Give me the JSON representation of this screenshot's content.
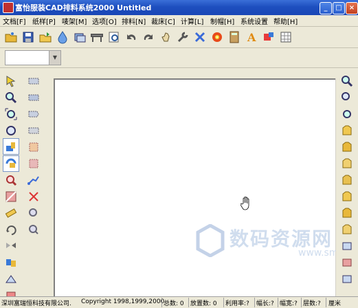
{
  "window": {
    "title": "富怡服装CAD排料系统2000 Untitled"
  },
  "menu": [
    "文档[F]",
    "纸样[P]",
    "唛架[M]",
    "选项[O]",
    "排料[N]",
    "裁床[C]",
    "计算[L]",
    "制帽[H]",
    "系统设置",
    "帮助[H]"
  ],
  "toolbar_icons": [
    "open-folder-icon",
    "save-icon",
    "open-icon",
    "drop-icon",
    "layer-icon",
    "table-icon",
    "preview-icon",
    "undo-icon",
    "redo-icon",
    "hand-icon",
    "wrench-icon",
    "tools-icon",
    "disc-icon",
    "calculator-icon",
    "text-icon",
    "color-icon",
    "grid-icon"
  ],
  "status": {
    "company": "深圳富瑞恒科技有限公司.",
    "copyright": "Copyright 1998,1999,2000",
    "total": "总数: 0",
    "placed": "放置数: 0",
    "usage": "利用率:?",
    "width_len": "幅长:?",
    "width": "幅宽:?",
    "layers": "层数:?",
    "unit": "厘米"
  },
  "watermark": {
    "text": "数码资源网",
    "url": "www.smzy.com"
  },
  "colors": {
    "title_bar": "#1e4fbf",
    "canvas": "#ffffff",
    "panel": "#ece9d8"
  }
}
